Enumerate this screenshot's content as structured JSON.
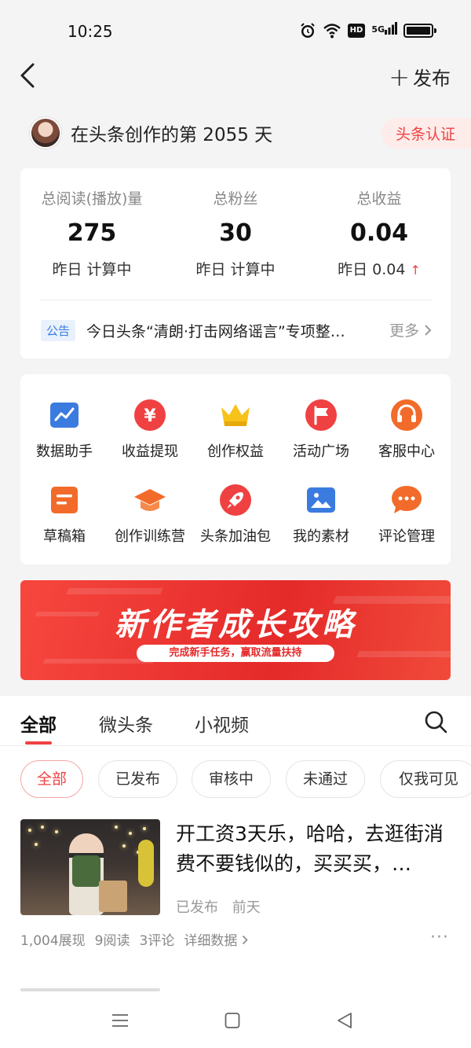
{
  "status_bar": {
    "time": "10:25",
    "icons": [
      "alarm-icon",
      "wifi-icon",
      "hd-icon",
      "5g-signal-icon",
      "battery-icon"
    ],
    "hd": "HD",
    "network": "5G"
  },
  "nav": {
    "back_icon": "chevron-left-icon",
    "publish_label": "发布",
    "publish_prefix": "+"
  },
  "creator": {
    "days_text": "在头条创作的第 2055 天",
    "cert_label": "头条认证"
  },
  "stats": [
    {
      "label": "总阅读(播放)量",
      "value": "275",
      "sub": "昨日 计算中"
    },
    {
      "label": "总粉丝",
      "value": "30",
      "sub": "昨日 计算中"
    },
    {
      "label": "总收益",
      "value": "0.04",
      "sub": "昨日 0.04",
      "trend": "↑"
    }
  ],
  "notice": {
    "tag": "公告",
    "text": "今日头条“清朗·打击网络谣言”专项整…",
    "more": "更多"
  },
  "tools": [
    {
      "label": "数据助手",
      "icon": "chart-icon",
      "color": "#3b7be0"
    },
    {
      "label": "收益提现",
      "icon": "yen-icon",
      "color": "#f04142"
    },
    {
      "label": "创作权益",
      "icon": "crown-icon",
      "color": "#f7c21a"
    },
    {
      "label": "活动广场",
      "icon": "flag-icon",
      "color": "#f04142"
    },
    {
      "label": "客服中心",
      "icon": "headset-icon",
      "color": "#f26b2a"
    },
    {
      "label": "草稿箱",
      "icon": "draft-icon",
      "color": "#f26b2a"
    },
    {
      "label": "创作训练营",
      "icon": "graduation-cap-icon",
      "color": "#f26b2a"
    },
    {
      "label": "头条加油包",
      "icon": "rocket-icon",
      "color": "#f04142"
    },
    {
      "label": "我的素材",
      "icon": "image-icon",
      "color": "#3b7be0"
    },
    {
      "label": "评论管理",
      "icon": "comment-icon",
      "color": "#f26b2a"
    }
  ],
  "banner": {
    "title": "新作者成长攻略",
    "subtitle": "完成新手任务，赢取流量扶持"
  },
  "tabs": [
    {
      "label": "全部",
      "active": true
    },
    {
      "label": "微头条",
      "active": false
    },
    {
      "label": "小视频",
      "active": false
    }
  ],
  "filters": [
    {
      "label": "全部",
      "active": true
    },
    {
      "label": "已发布",
      "active": false
    },
    {
      "label": "审核中",
      "active": false
    },
    {
      "label": "未通过",
      "active": false
    },
    {
      "label": "仅我可见",
      "active": false
    }
  ],
  "article": {
    "title": "开工资3天乐，哈哈，去逛街消费不要钱似的，买买买，…",
    "status": "已发布",
    "time": "前天",
    "impressions": "1,004展现",
    "reads": "9阅读",
    "comments": "3评论",
    "details": "详细数据",
    "more": "···"
  }
}
